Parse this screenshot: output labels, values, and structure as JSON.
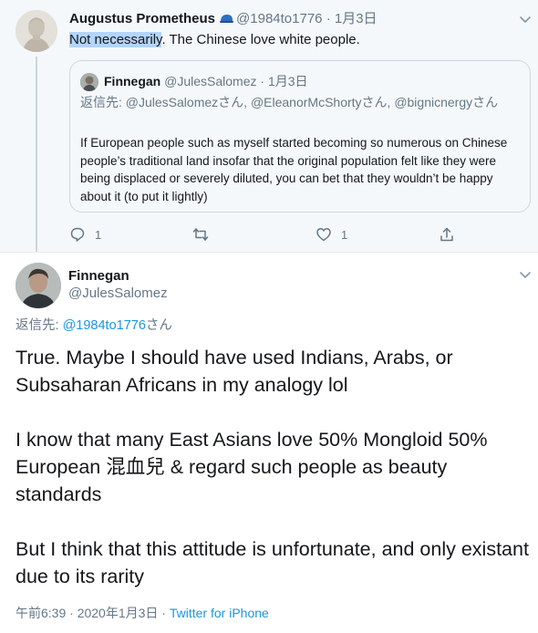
{
  "reply_tweet": {
    "author_name": "Augustus Prometheus",
    "author_handle": "@1984to1776",
    "separator": "·",
    "date": "1月3日",
    "text_highlighted": "Not necessarily",
    "text_rest": ". The Chinese love white people.",
    "quoted_tweet": {
      "author_name": "Finnegan",
      "author_handle": "@JulesSalomez",
      "separator": "·",
      "date": "1月3日",
      "reply_prefix": "返信先: ",
      "reply_to_1": "@JulesSalomez",
      "san_1": "さん, ",
      "reply_to_2": "@EleanorMcShorty",
      "san_2": "さん, ",
      "reply_to_3": "@bignicnergy",
      "san_3": "さん",
      "body": "If European people such as myself started becoming so numerous on Chinese people’s traditional land insofar that the original population felt like they were being displaced or severely diluted, you can bet that they wouldn’t be happy about it (to put it lightly)"
    },
    "actions": {
      "reply_count": "1",
      "retweet_count": "",
      "like_count": "1"
    }
  },
  "main_tweet": {
    "author_name": "Finnegan",
    "author_handle": "@JulesSalomez",
    "reply_prefix": "返信先: ",
    "reply_to": "@1984to1776",
    "reply_suffix": "さん",
    "paragraphs": [
      "True. Maybe I should have used Indians, Arabs, or Subsaharan Africans in my analogy lol",
      "I know that many East Asians love 50% Mongloid 50% European 混血兒 & regard such people as beauty standards",
      "But I think that this attitude is unfortunate, and only existant due to its rarity"
    ],
    "timestamp": "午前6:39 · 2020年1月3日 · ",
    "source": "Twitter for iPhone"
  },
  "colors": {
    "link": "#1b95e0",
    "muted": "#657786",
    "reply_background": "#f5f8fa",
    "selection_highlight": "#b3d4fc"
  }
}
